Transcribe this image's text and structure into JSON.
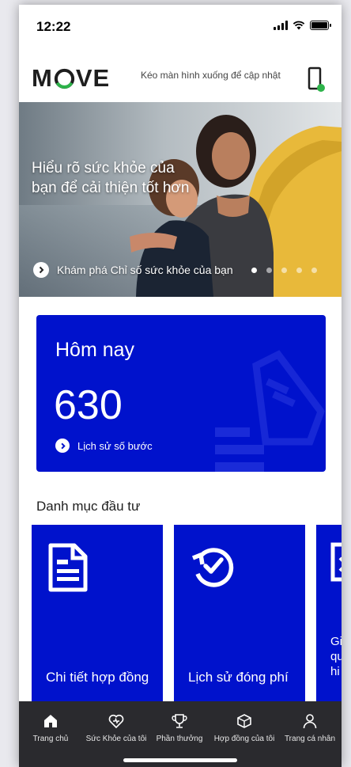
{
  "status_bar": {
    "time": "12:22"
  },
  "header": {
    "logo_text_left": "M",
    "logo_text_right": "VE",
    "refresh_hint": "Kéo màn hình xuống để cập nhật"
  },
  "hero": {
    "title": "Hiểu rõ sức khỏe của bạn để cải thiện tốt hơn",
    "link_label": "Khám phá Chỉ số sức khỏe của bạn",
    "slide_count": 5,
    "active_slide": 1
  },
  "today": {
    "label": "Hôm nay",
    "value": "630",
    "link_label": "Lịch sử số bước"
  },
  "investment": {
    "title": "Danh mục đầu tư",
    "tiles": [
      {
        "label": "Chi tiết hợp đồng",
        "icon": "document-icon"
      },
      {
        "label": "Lịch sử đóng phí",
        "icon": "history-check-icon"
      },
      {
        "label": "Gi\nqu\nhi",
        "icon": "partial-icon"
      }
    ]
  },
  "bottom_nav": {
    "items": [
      {
        "label": "Trang chủ",
        "icon": "home-icon",
        "active": true
      },
      {
        "label": "Sức Khỏe của tôi",
        "icon": "heart-icon"
      },
      {
        "label": "Phần thưởng",
        "icon": "trophy-icon"
      },
      {
        "label": "Hợp đồng của tôi",
        "icon": "box-icon"
      },
      {
        "label": "Trang cá nhân",
        "icon": "person-icon"
      }
    ]
  },
  "colors": {
    "brand_blue": "#0012CC",
    "logo_green": "#2DB34A",
    "nav_bg": "#2A2A2E"
  }
}
